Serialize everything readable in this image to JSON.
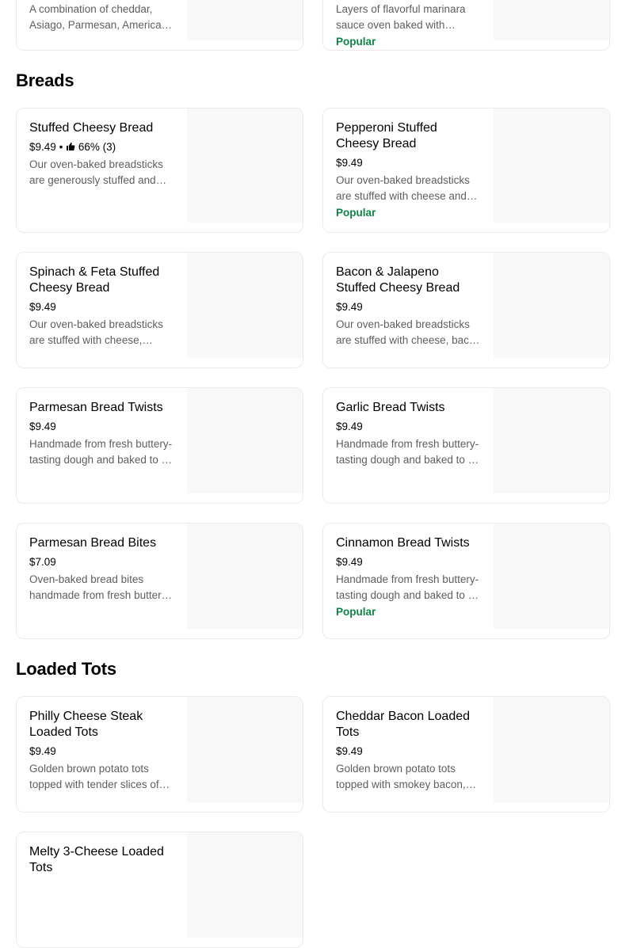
{
  "top_partial": {
    "left": {
      "desc": "A combination of cheddar, Asiago, Parmesan, American and Romano cheese"
    },
    "right": {
      "desc": "Layers of flavorful marinara sauce oven baked with cheese",
      "badge": "Popular"
    }
  },
  "sections": [
    {
      "title": "Breads",
      "items": [
        {
          "name": "Stuffed Cheesy Bread",
          "price": "$9.49",
          "rating": "66% (3)",
          "desc": "Our oven-baked breadsticks are generously stuffed and covered with cheese"
        },
        {
          "name": "Pepperoni Stuffed Cheesy Bread",
          "price": "$9.49",
          "desc": "Our oven-baked breadsticks are stuffed with cheese and pepperoni",
          "badge": "Popular"
        },
        {
          "name": "Spinach & Feta Stuffed Cheesy Bread",
          "price": "$9.49",
          "desc": "Our oven-baked breadsticks are stuffed with cheese, spinach and feta"
        },
        {
          "name": "Bacon & Jalapeno Stuffed Cheesy Bread",
          "price": "$9.49",
          "desc": "Our oven-baked breadsticks are stuffed with cheese, bacon and jalapeno"
        },
        {
          "name": "Parmesan Bread Twists",
          "price": "$9.49",
          "desc": "Handmade from fresh buttery-tasting dough and baked to a golden brown"
        },
        {
          "name": "Garlic Bread Twists",
          "price": "$9.49",
          "desc": "Handmade from fresh buttery-tasting dough and baked to a golden brown"
        },
        {
          "name": "Parmesan Bread Bites",
          "price": "$7.09",
          "desc": "Oven-baked bread bites handmade from fresh buttery-tasting dough"
        },
        {
          "name": "Cinnamon Bread Twists",
          "price": "$9.49",
          "desc": "Handmade from fresh buttery-tasting dough and baked to a golden brown",
          "badge": "Popular"
        }
      ]
    },
    {
      "title": "Loaded Tots",
      "items": [
        {
          "name": "Philly Cheese Steak Loaded Tots",
          "price": "$9.49",
          "desc": "Golden brown potato tots topped with tender slices of steak"
        },
        {
          "name": "Cheddar Bacon Loaded Tots",
          "price": "$9.49",
          "desc": "Golden brown potato tots topped with smokey bacon, cheddar"
        },
        {
          "name": "Melty 3-Cheese Loaded Tots",
          "price": "",
          "desc": ""
        }
      ]
    }
  ],
  "colors": {
    "popular": "#0e8345",
    "muted": "#5e5e5e",
    "border": "#ebebeb",
    "image_placeholder": "#f8f8f8"
  }
}
